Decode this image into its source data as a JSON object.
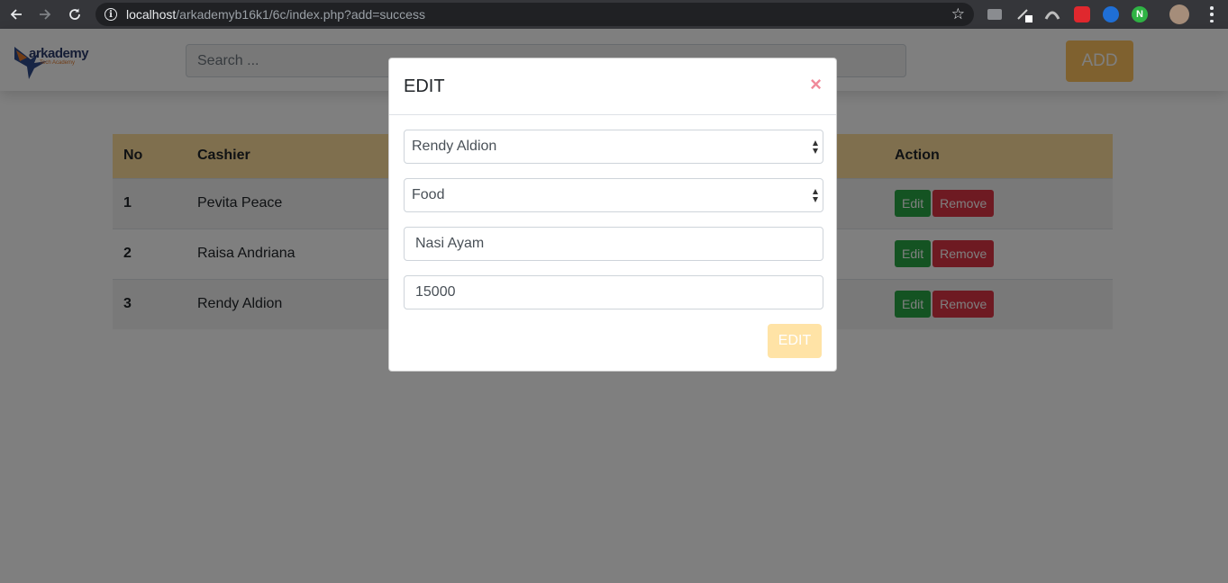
{
  "browser": {
    "url_host": "localhost",
    "url_path": "/arkademyb16k1/6c/index.php?add=success"
  },
  "header": {
    "logo_text": "arkademy",
    "logo_subtext": "Tech Academy",
    "search_placeholder": "Search ...",
    "add_label": "ADD"
  },
  "table": {
    "columns": [
      "No",
      "Cashier",
      "Action"
    ],
    "rows": [
      {
        "no": "1",
        "cashier": "Pevita Peace"
      },
      {
        "no": "2",
        "cashier": "Raisa Andriana"
      },
      {
        "no": "3",
        "cashier": "Rendy Aldion"
      }
    ],
    "edit_label": "Edit",
    "remove_label": "Remove"
  },
  "modal": {
    "title": "EDIT",
    "close_symbol": "×",
    "cashier_select": "Rendy Aldion",
    "category_select": "Food",
    "name_value": "Nasi Ayam",
    "price_value": "15000",
    "submit_label": "EDIT"
  },
  "colors": {
    "header_bg": "#ffdf9c",
    "add_button": "#ffc25e",
    "edit_button": "#28a745",
    "remove_button": "#dc3545"
  }
}
